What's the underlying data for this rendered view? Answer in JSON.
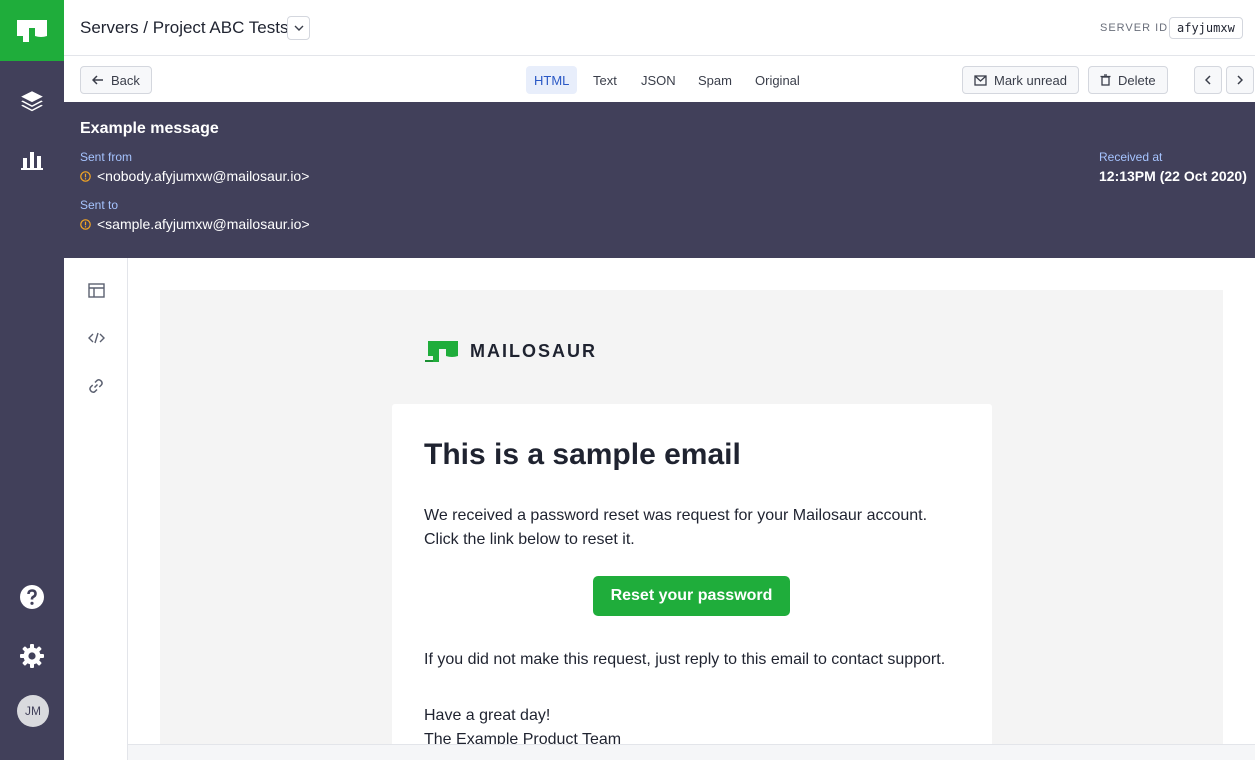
{
  "header": {
    "title": "Servers / Project ABC Tests",
    "server_id_label": "SERVER ID:",
    "server_id": "afyjumxw"
  },
  "toolbar": {
    "back_label": "Back",
    "tabs": [
      "HTML",
      "Text",
      "JSON",
      "Spam",
      "Original"
    ],
    "active_tab": "HTML",
    "mark_unread_label": "Mark unread",
    "delete_label": "Delete"
  },
  "message": {
    "subject": "Example message",
    "sent_from_label": "Sent from",
    "sent_from": "<nobody.afyjumxw@mailosaur.io>",
    "sent_to_label": "Sent to",
    "sent_to": "<sample.afyjumxw@mailosaur.io>",
    "received_label": "Received at",
    "received": "12:13PM (22 Oct 2020)"
  },
  "email": {
    "brand": "MAILOSAUR",
    "title": "This is a sample email",
    "line1": "We received a password reset was request for your Mailosaur account.",
    "line2": "Click the link below to reset it.",
    "button": "Reset your password",
    "line3": "If you did not make this request, just reply to this email to contact support.",
    "sign1": "Have a great day!",
    "sign2": "The Example Product Team"
  },
  "user": {
    "initials": "JM"
  },
  "colors": {
    "brand_green": "#1fad3b",
    "rail": "#41405a",
    "meta_label": "#a6c4ff",
    "warning": "#f5a623"
  }
}
